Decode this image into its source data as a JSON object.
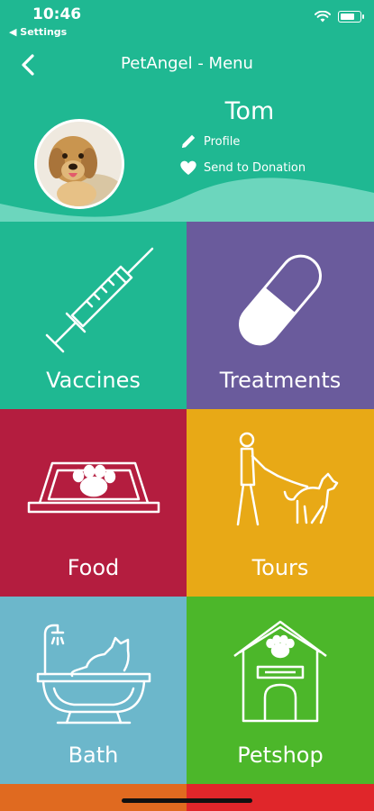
{
  "status_bar": {
    "time": "10:46",
    "back_app": "◀ Settings",
    "battery_level": 0.75
  },
  "navbar": {
    "title": "PetAngel - Menu",
    "back_icon": "chevron-left-icon"
  },
  "profile": {
    "name": "Tom",
    "links": [
      {
        "label": "Profile",
        "icon": "pencil-icon"
      },
      {
        "label": "Send to Donation",
        "icon": "heart-icon"
      }
    ]
  },
  "menu": {
    "tiles": [
      {
        "label": "Vaccines",
        "icon": "syringe-icon",
        "color": "#1fb892"
      },
      {
        "label": "Treatments",
        "icon": "pill-icon",
        "color": "#6a5b9c"
      },
      {
        "label": "Food",
        "icon": "food-bowl-icon",
        "color": "#b41d3f"
      },
      {
        "label": "Tours",
        "icon": "dog-walk-icon",
        "color": "#e8a916"
      },
      {
        "label": "Bath",
        "icon": "bathtub-icon",
        "color": "#6cb7cb"
      },
      {
        "label": "Petshop",
        "icon": "pet-house-icon",
        "color": "#4cb72a"
      }
    ]
  },
  "colors": {
    "header": "#1fb892",
    "wave": "#6cd6bd",
    "strip_left": "#e06a20",
    "strip_right": "#e0262a"
  }
}
